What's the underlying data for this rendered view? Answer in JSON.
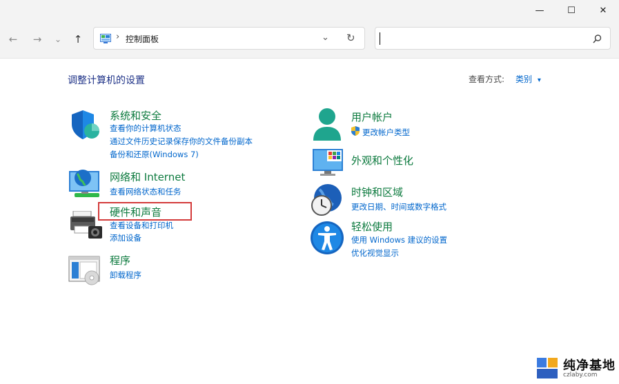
{
  "window": {
    "minimize": "—",
    "maximize": "☐",
    "close": "✕"
  },
  "nav": {
    "back": "←",
    "forward": "→",
    "recent": "⌄",
    "up": "↑",
    "breadcrumb_sep": "›",
    "breadcrumb": "控制面板",
    "dropdown": "⌄",
    "refresh": "↻",
    "search_value": ""
  },
  "main": {
    "title": "调整计算机的设置",
    "view_by_label": "查看方式:",
    "view_by_value": "类别",
    "view_by_arrow": "▾"
  },
  "categories": [
    {
      "title": "系统和安全",
      "links": [
        "查看你的计算机状态",
        "通过文件历史记录保存你的文件备份副本",
        "备份和还原(Windows 7)"
      ]
    },
    {
      "title": "网络和 Internet",
      "links": [
        "查看网络状态和任务"
      ]
    },
    {
      "title": "硬件和声音",
      "links": [
        "查看设备和打印机",
        "添加设备"
      ]
    },
    {
      "title": "程序",
      "links": [
        "卸载程序"
      ]
    },
    {
      "title": "用户帐户",
      "links": [
        "更改帐户类型"
      ]
    },
    {
      "title": "外观和个性化",
      "links": []
    },
    {
      "title": "时钟和区域",
      "links": [
        "更改日期、时间或数字格式"
      ]
    },
    {
      "title": "轻松使用",
      "links": [
        "使用 Windows 建议的设置",
        "优化视觉显示"
      ]
    }
  ],
  "watermark": {
    "text": "纯净基地",
    "sub": "czlaby.com"
  },
  "colors": {
    "category_title": "#0c7a3e",
    "link": "#0066cc",
    "heading": "#1e3287",
    "highlight_box": "#d33a3a",
    "chrome": "#f3f3f3"
  }
}
